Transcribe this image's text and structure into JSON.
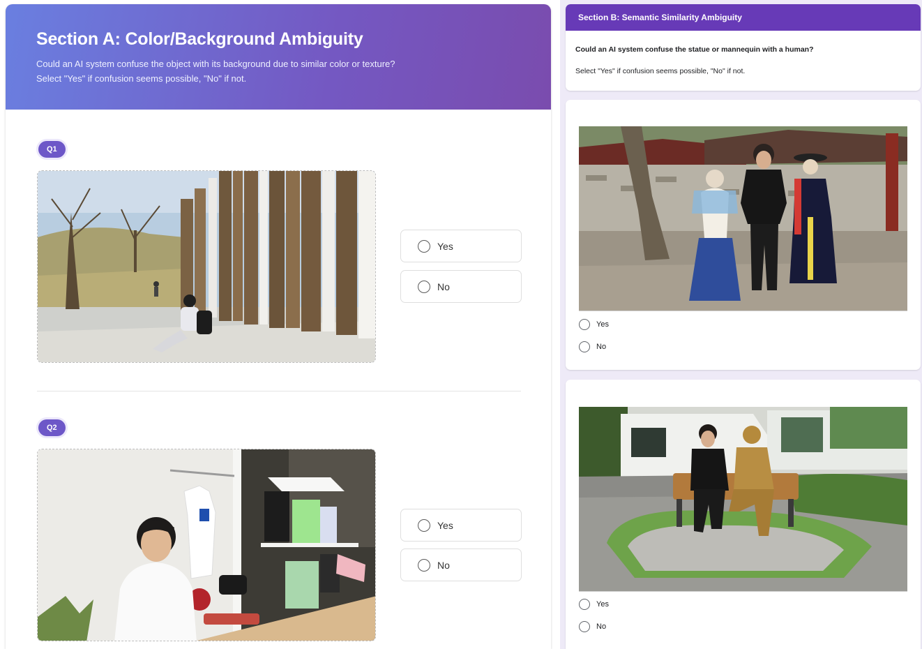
{
  "section_a": {
    "title": "Section A: Color/Background Ambiguity",
    "instruction_line1": "Could an AI system confuse the object with its background due to similar color or texture?",
    "instruction_line2": "Select \"Yes\" if confusion seems possible, \"No\" if not.",
    "questions": [
      {
        "badge": "Q1",
        "options": [
          "Yes",
          "No"
        ]
      },
      {
        "badge": "Q2",
        "options": [
          "Yes",
          "No"
        ]
      }
    ]
  },
  "section_b": {
    "title": "Section B: Semantic Similarity Ambiguity",
    "question": "Could an AI system confuse the statue or mannequin with a human?",
    "instruction": "Select \"Yes\" if confusion seems possible, \"No\" if not.",
    "questions": [
      {
        "options": [
          "Yes",
          "No"
        ]
      },
      {
        "options": [
          "Yes",
          "No"
        ]
      }
    ]
  },
  "colors": {
    "header_gradient_start": "#6a7fe0",
    "header_gradient_end": "#7a4cae",
    "badge": "#6d57c8",
    "forms_purple": "#673ab7",
    "right_background": "#eeeaf7"
  },
  "icons": [
    "radio-unchecked-icon"
  ]
}
